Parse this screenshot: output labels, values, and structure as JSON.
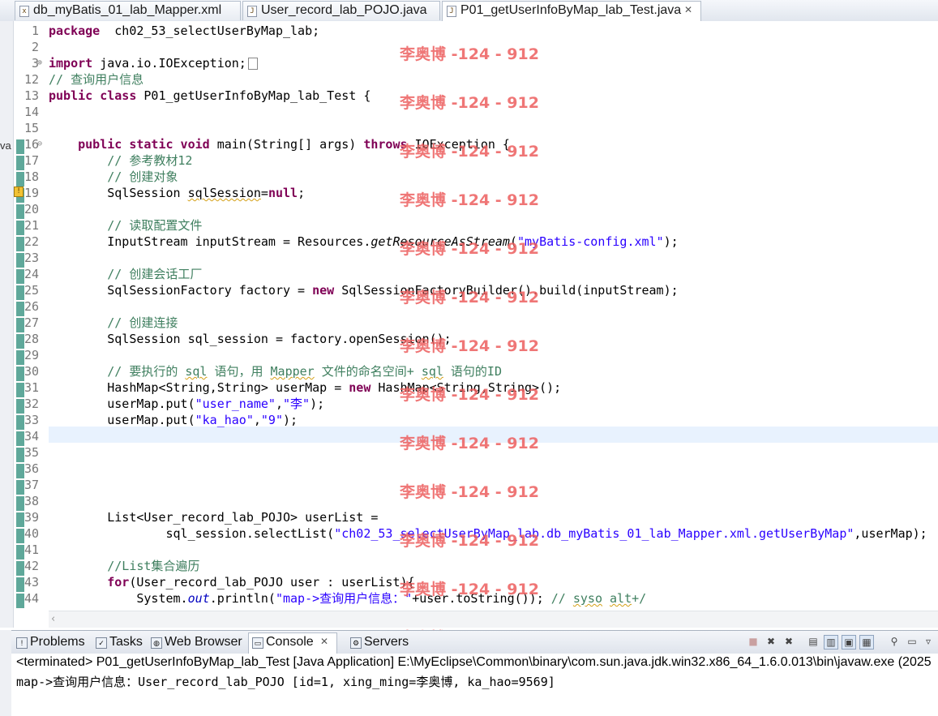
{
  "tabs": [
    {
      "label": "db_myBatis_01_lab_Mapper.xml",
      "icon": "xml-file-icon",
      "active": false
    },
    {
      "label": "User_record_lab_POJO.java",
      "icon": "java-file-icon",
      "active": false
    },
    {
      "label": "P01_getUserInfoByMap_lab_Test.java",
      "icon": "java-file-icon",
      "active": true,
      "close": "✕"
    }
  ],
  "editor": {
    "left_fragment": "va",
    "lines": [
      {
        "n": "1",
        "segs": [
          [
            "kw",
            "package"
          ],
          [
            "",
            "  ch02_53_selectUserByMap_lab;"
          ]
        ]
      },
      {
        "n": "2",
        "segs": []
      },
      {
        "n": "3",
        "fold": "⊕",
        "segs": [
          [
            "kw",
            "import"
          ],
          [
            "",
            " java.io.IOException;"
          ]
        ],
        "box": true
      },
      {
        "n": "12",
        "segs": [
          [
            "cm",
            "// 查询用户信息"
          ]
        ]
      },
      {
        "n": "13",
        "segs": [
          [
            "kw",
            "public class"
          ],
          [
            "",
            " P01_getUserInfoByMap_lab_Test {"
          ]
        ]
      },
      {
        "n": "14",
        "segs": []
      },
      {
        "n": "15",
        "segs": []
      },
      {
        "n": "16",
        "fold": "⊖",
        "segs": [
          [
            "",
            "    "
          ],
          [
            "kw",
            "public static void"
          ],
          [
            "",
            " main(String[] args) "
          ],
          [
            "kw",
            "throws"
          ],
          [
            "",
            " IOException {"
          ]
        ]
      },
      {
        "n": "17",
        "segs": [
          [
            "",
            "        "
          ],
          [
            "cm",
            "// 参考教材12"
          ]
        ]
      },
      {
        "n": "18",
        "segs": [
          [
            "",
            "        "
          ],
          [
            "cm",
            "// 创建对象"
          ]
        ]
      },
      {
        "n": "19",
        "segs": [
          [
            "",
            "        SqlSession "
          ],
          [
            "sq",
            "sqlSession"
          ],
          [
            "",
            "="
          ],
          [
            "kw",
            "null"
          ],
          [
            "",
            ";"
          ]
        ]
      },
      {
        "n": "20",
        "segs": []
      },
      {
        "n": "21",
        "segs": [
          [
            "",
            "        "
          ],
          [
            "cm",
            "// 读取配置文件"
          ]
        ]
      },
      {
        "n": "22",
        "segs": [
          [
            "",
            "        InputStream inputStream = Resources."
          ],
          [
            "it",
            "getResourceAsStream"
          ],
          [
            "",
            "("
          ],
          [
            "str",
            "\"myBatis-config.xml\""
          ],
          [
            "",
            ");"
          ]
        ]
      },
      {
        "n": "23",
        "segs": []
      },
      {
        "n": "24",
        "segs": [
          [
            "",
            "        "
          ],
          [
            "cm",
            "// 创建会话工厂"
          ]
        ]
      },
      {
        "n": "25",
        "segs": [
          [
            "",
            "        SqlSessionFactory factory = "
          ],
          [
            "kw",
            "new"
          ],
          [
            "",
            " SqlSessionFactoryBuilder().build(inputStream);"
          ]
        ]
      },
      {
        "n": "26",
        "segs": []
      },
      {
        "n": "27",
        "segs": [
          [
            "",
            "        "
          ],
          [
            "cm",
            "// 创建连接"
          ]
        ]
      },
      {
        "n": "28",
        "segs": [
          [
            "",
            "        SqlSession sql_session = factory.openSession();"
          ]
        ]
      },
      {
        "n": "29",
        "segs": []
      },
      {
        "n": "30",
        "segs": [
          [
            "",
            "        "
          ],
          [
            "cm",
            "// 要执行的 "
          ],
          [
            "cm sq",
            "sql"
          ],
          [
            "cm",
            " 语句，用 "
          ],
          [
            "cm sq",
            "Mapper"
          ],
          [
            "cm",
            " 文件的命名空间+ "
          ],
          [
            "cm sq",
            "sql"
          ],
          [
            "cm",
            " 语句的ID"
          ]
        ]
      },
      {
        "n": "31",
        "segs": [
          [
            "",
            "        HashMap<String,String> userMap = "
          ],
          [
            "kw",
            "new"
          ],
          [
            "",
            " HashMap<String,String>();"
          ]
        ]
      },
      {
        "n": "32",
        "segs": [
          [
            "",
            "        userMap.put("
          ],
          [
            "str",
            "\"user_name\""
          ],
          [
            "",
            ","
          ],
          [
            "str",
            "\"李\""
          ],
          [
            "",
            ");"
          ]
        ]
      },
      {
        "n": "33",
        "segs": [
          [
            "",
            "        userMap.put("
          ],
          [
            "str",
            "\"ka_hao\""
          ],
          [
            "",
            ","
          ],
          [
            "str",
            "\"9\""
          ],
          [
            "",
            ");"
          ]
        ]
      },
      {
        "n": "34",
        "segs": [],
        "current": true
      },
      {
        "n": "35",
        "segs": []
      },
      {
        "n": "36",
        "segs": []
      },
      {
        "n": "37",
        "segs": []
      },
      {
        "n": "38",
        "segs": []
      },
      {
        "n": "39",
        "segs": [
          [
            "",
            "        List<User_record_lab_POJO> userList ="
          ]
        ]
      },
      {
        "n": "40",
        "segs": [
          [
            "",
            "                sql_session.selectList("
          ],
          [
            "str",
            "\"ch02_53_selectUserByMap_lab.db_myBatis_01_lab_Mapper.xml.getUserByMap\""
          ],
          [
            "",
            ",userMap);"
          ]
        ]
      },
      {
        "n": "41",
        "segs": []
      },
      {
        "n": "42",
        "segs": [
          [
            "",
            "        "
          ],
          [
            "cm",
            "//List集合遍历"
          ]
        ]
      },
      {
        "n": "43",
        "segs": [
          [
            "",
            "        "
          ],
          [
            "kw",
            "for"
          ],
          [
            "",
            "(User_record_lab_POJO user : userList){"
          ]
        ]
      },
      {
        "n": "44",
        "segs": [
          [
            "",
            "            System."
          ],
          [
            "st",
            "out"
          ],
          [
            "",
            ".println("
          ],
          [
            "str",
            "\"map->查询用户信息：\""
          ],
          [
            "",
            "+user.toString()); "
          ],
          [
            "cm",
            "// "
          ],
          [
            "cm sq",
            "syso"
          ],
          [
            "cm",
            " "
          ],
          [
            "cm sq",
            "alt"
          ],
          [
            "cm",
            "+/"
          ]
        ]
      }
    ]
  },
  "watermark": {
    "text": "李奥博 -124 - 912",
    "count": 14,
    "color": "#ed5f5f"
  },
  "views": {
    "tabs": [
      {
        "label": "Problems",
        "icon": "problems-icon"
      },
      {
        "label": "Tasks",
        "icon": "tasks-icon"
      },
      {
        "label": "Web Browser",
        "icon": "globe-icon"
      },
      {
        "label": "Console",
        "icon": "console-icon",
        "active": true,
        "close": "✕"
      },
      {
        "label": "Servers",
        "icon": "servers-icon"
      }
    ],
    "toolbar": [
      {
        "name": "terminate-icon",
        "glyph": "■"
      },
      {
        "name": "remove-launch-icon",
        "glyph": "✖"
      },
      {
        "name": "remove-all-icon",
        "glyph": "✖"
      },
      {
        "name": "clear-console-icon",
        "glyph": "▤"
      },
      {
        "name": "scroll-lock-icon",
        "glyph": "▥"
      },
      {
        "name": "show-stdout-icon",
        "glyph": "▣"
      },
      {
        "name": "show-stderr-icon",
        "glyph": "▦"
      },
      {
        "name": "pin-console-icon",
        "glyph": "⚲"
      },
      {
        "name": "display-console-icon",
        "glyph": "▭"
      },
      {
        "name": "open-console-icon",
        "glyph": "▿"
      }
    ]
  },
  "console": {
    "line1": "<terminated> P01_getUserInfoByMap_lab_Test [Java Application] E:\\MyEclipse\\Common\\binary\\com.sun.java.jdk.win32.x86_64_1.6.0.013\\bin\\javaw.exe (2025",
    "line2": "map->查询用户信息：User_record_lab_POJO [id=1, xing_ming=李奥博, ka_hao=9569]"
  }
}
